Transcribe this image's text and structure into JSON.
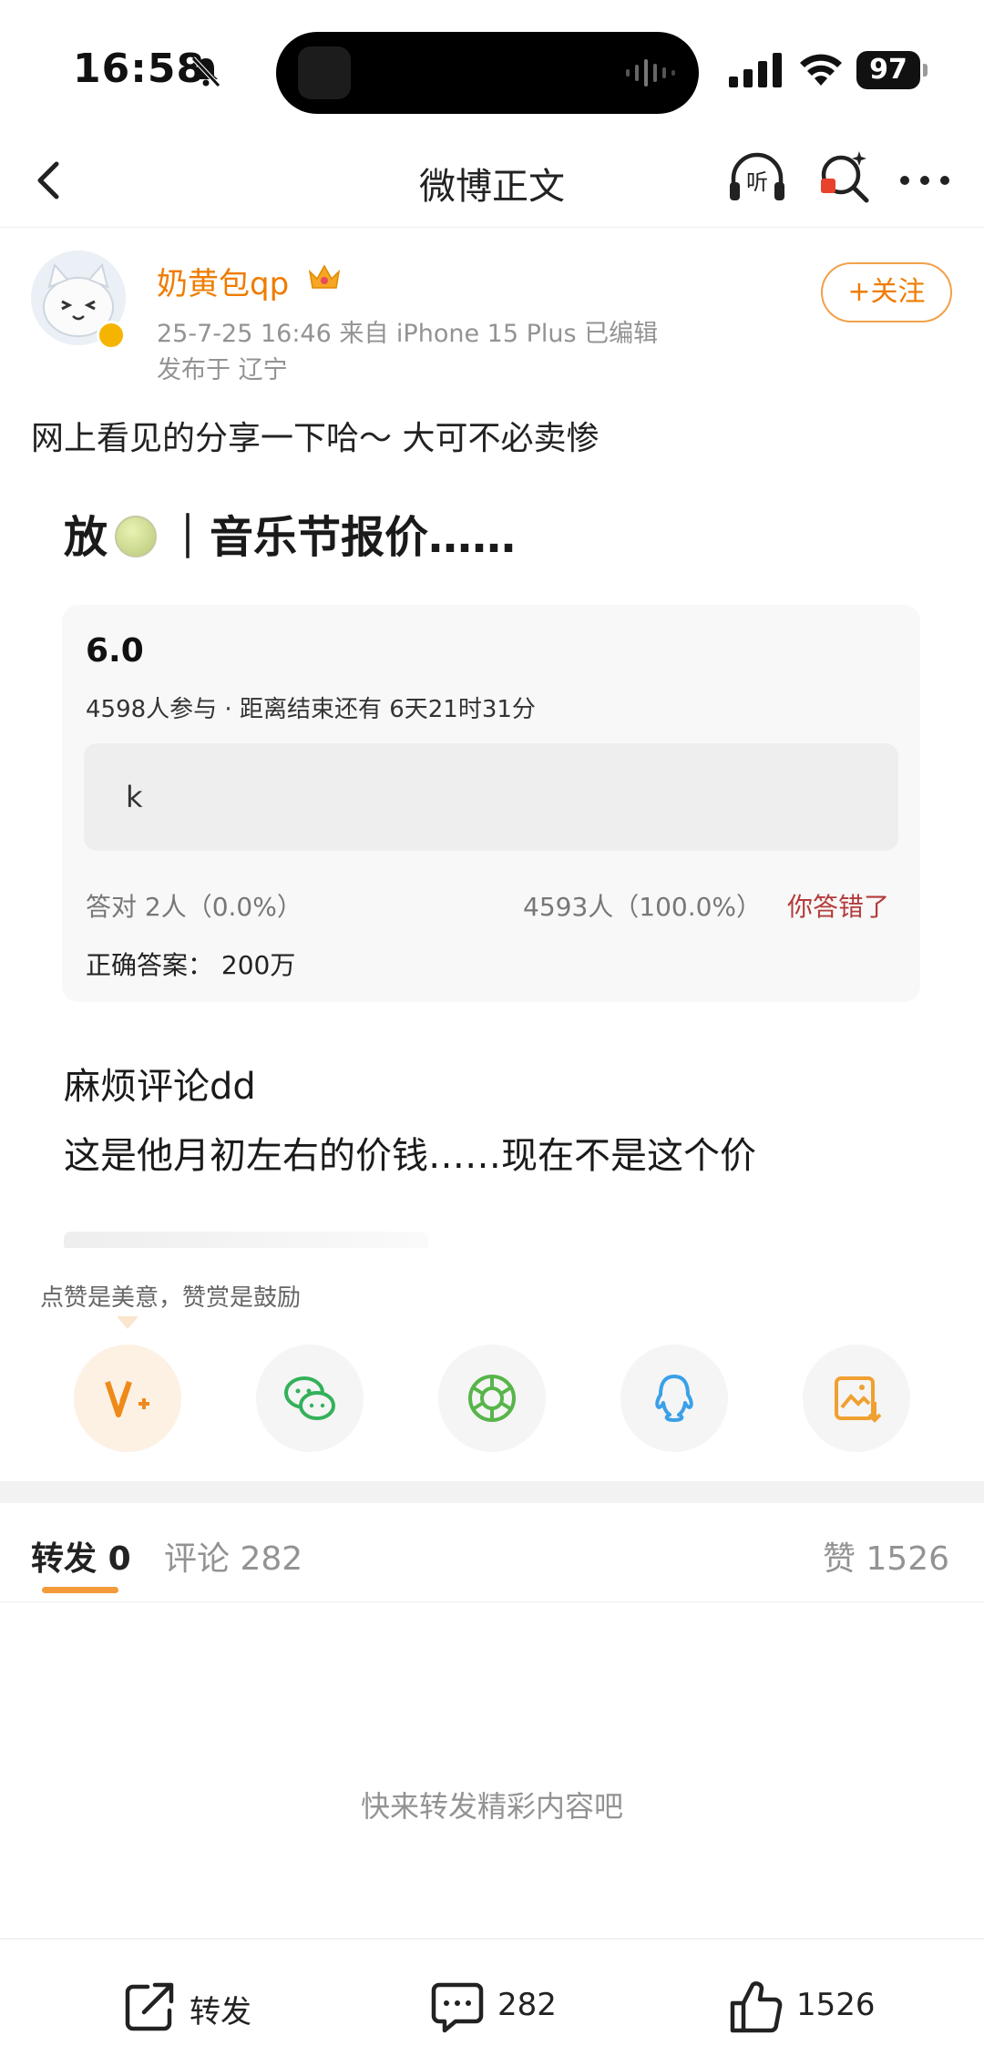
{
  "status_bar": {
    "time": "16:58",
    "battery": "97"
  },
  "nav": {
    "title": "微博正文"
  },
  "author": {
    "name": "奶黄包qp",
    "meta": "25-7-25 16:46  来自 iPhone 15 Plus  已编辑",
    "location": "发布于 辽宁",
    "follow_label": "+关注"
  },
  "post": {
    "text": "网上看见的分享一下哈～ 大可不必卖惨"
  },
  "image": {
    "title_left": "放",
    "title_right": "｜音乐节报价……",
    "score": "6.0",
    "participants": "4598人参与 · 距离结束还有 6天21时31分",
    "answer": "k",
    "correct_count": "答对  2人（0.0%）",
    "wrong_count": "4593人（100.0%）",
    "you_wrong": "你答错了",
    "right_answer": "正确答案：  200万",
    "line1": "麻烦评论dd",
    "line2": "这是他月初左右的价钱……现在不是这个价"
  },
  "reward_tip": "点赞是美意，赞赏是鼓励",
  "share_icons": [
    "reward-icon",
    "wechat-icon",
    "moments-icon",
    "qq-icon",
    "save-image-icon"
  ],
  "tabs": {
    "repost_label": "转发",
    "repost_count": "0",
    "comment": "评论 282",
    "like": "赞 1526"
  },
  "empty_text": "快来转发精彩内容吧",
  "bottom": {
    "repost": "转发",
    "comment": "282",
    "like": "1526"
  },
  "colors": {
    "accent": "#ef7c00",
    "indicator": "#f39a3a",
    "wrong": "#b43b3b"
  }
}
